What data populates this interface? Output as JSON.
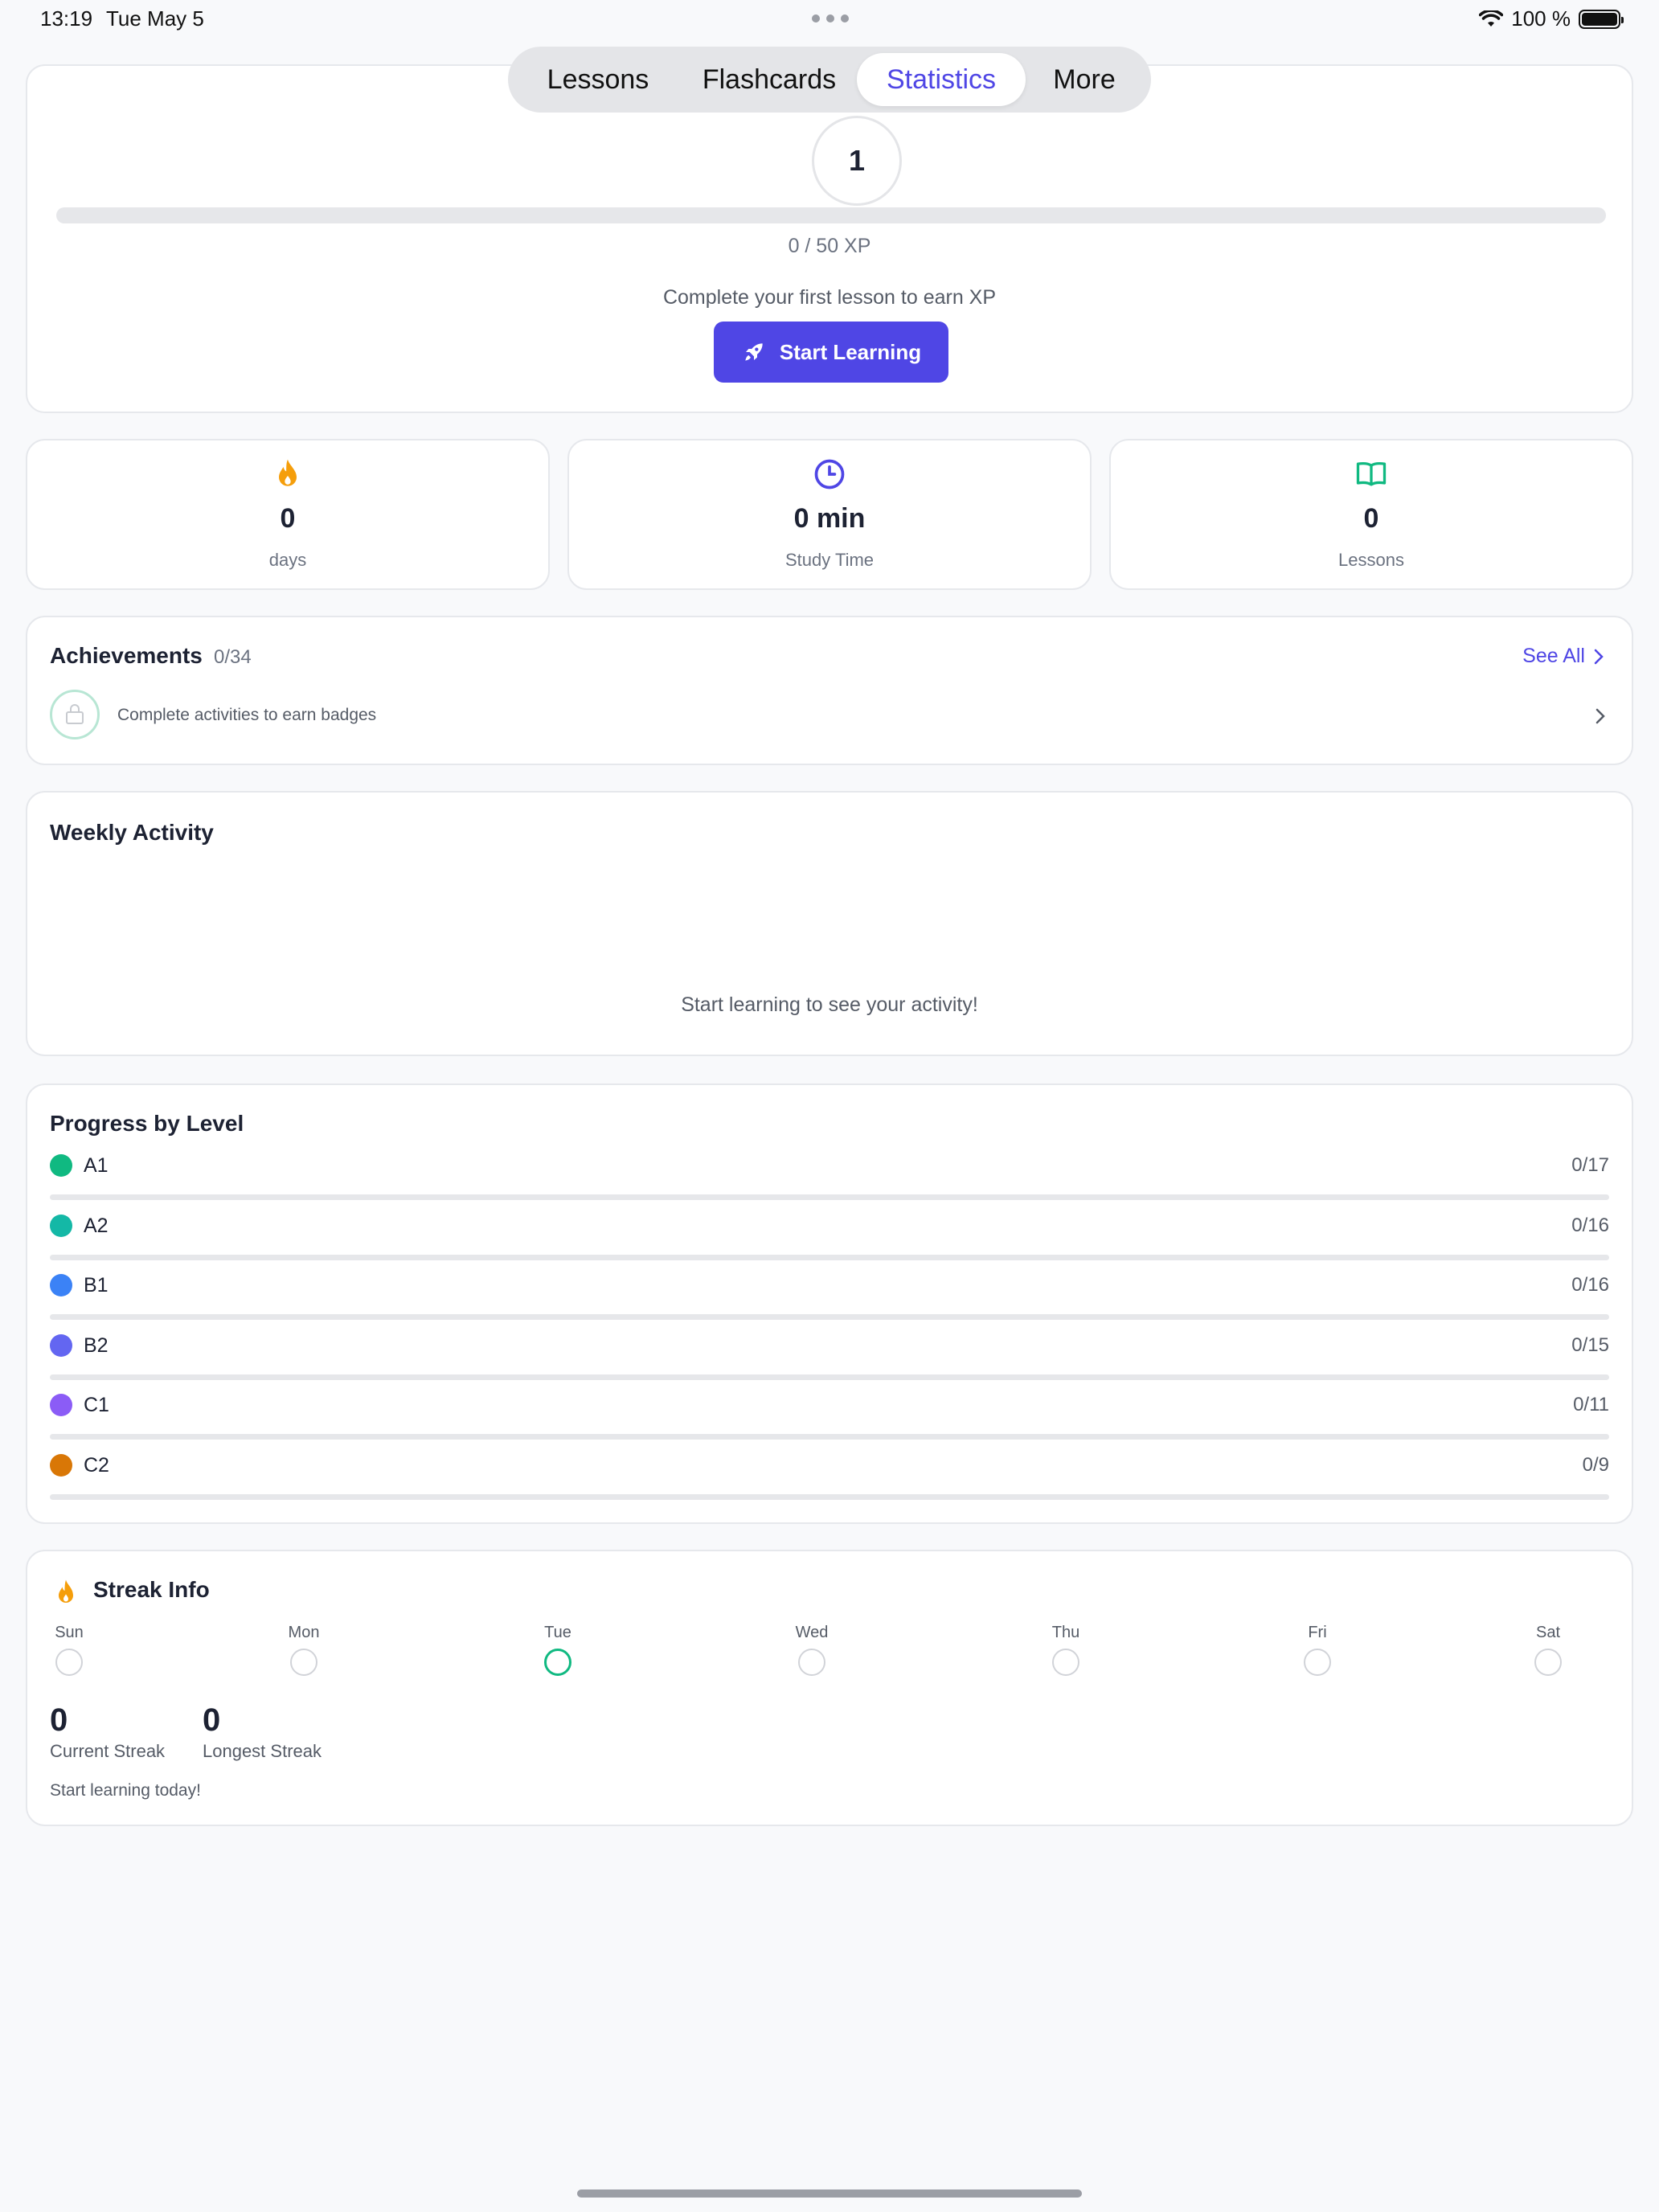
{
  "status_bar": {
    "time": "13:19",
    "date": "Tue May 5",
    "battery": "100 %"
  },
  "nav": {
    "tabs": [
      "Lessons",
      "Flashcards",
      "Statistics",
      "More"
    ],
    "active": "Statistics"
  },
  "level": {
    "number": "1",
    "xp_text": "0 / 50 XP",
    "xp_progress": 0,
    "hint": "Complete your first lesson to earn XP",
    "start_button": "Start Learning"
  },
  "stats": [
    {
      "icon": "flame-icon",
      "value": "0",
      "label": "days",
      "color": "#f59e0b"
    },
    {
      "icon": "clock-icon",
      "value": "0 min",
      "label": "Study Time",
      "color": "#4f46e5"
    },
    {
      "icon": "book-icon",
      "value": "0",
      "label": "Lessons",
      "color": "#10b981"
    }
  ],
  "achievements": {
    "title": "Achievements",
    "count": "0/34",
    "see_all": "See All",
    "hint": "Complete activities to earn badges"
  },
  "weekly": {
    "title": "Weekly Activity",
    "empty": "Start learning to see your activity!"
  },
  "progress": {
    "title": "Progress by Level",
    "levels": [
      {
        "name": "A1",
        "count": "0/17",
        "progress": 0,
        "color": "#10b981"
      },
      {
        "name": "A2",
        "count": "0/16",
        "progress": 0,
        "color": "#14b8a6"
      },
      {
        "name": "B1",
        "count": "0/16",
        "progress": 0,
        "color": "#3b82f6"
      },
      {
        "name": "B2",
        "count": "0/15",
        "progress": 0,
        "color": "#6366f1"
      },
      {
        "name": "C1",
        "count": "0/11",
        "progress": 0,
        "color": "#8b5cf6"
      },
      {
        "name": "C2",
        "count": "0/9",
        "progress": 0,
        "color": "#d97706"
      }
    ]
  },
  "streak": {
    "title": "Streak Info",
    "days": [
      "Sun",
      "Mon",
      "Tue",
      "Wed",
      "Thu",
      "Fri",
      "Sat"
    ],
    "today": "Tue",
    "current": "0",
    "current_label": "Current Streak",
    "longest": "0",
    "longest_label": "Longest Streak",
    "hint": "Start learning today!"
  },
  "colors": {
    "accent": "#4f46e5",
    "flame": "#f59e0b",
    "success": "#10b981"
  }
}
